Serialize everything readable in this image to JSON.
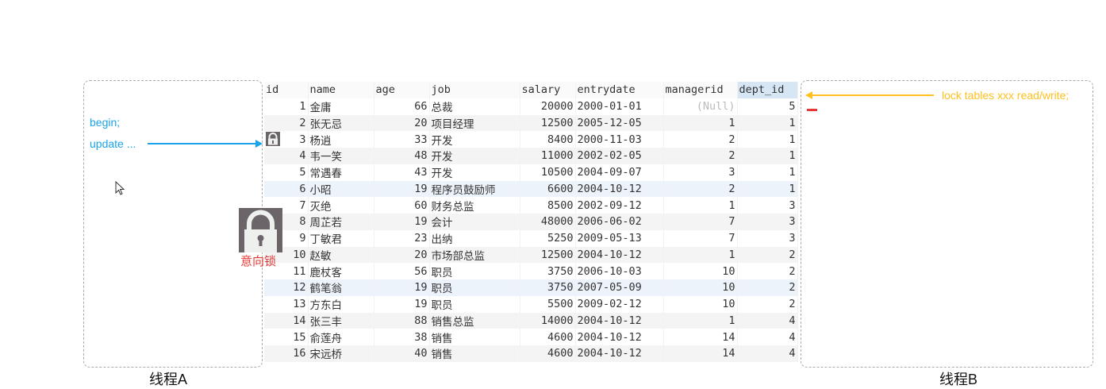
{
  "threadA": {
    "label": "线程A",
    "lines": [
      "begin;",
      "update ..."
    ]
  },
  "threadB": {
    "label": "线程B",
    "statement": "lock tables xxx read/write;"
  },
  "lock": {
    "label": "意向锁"
  },
  "colors": {
    "blue": "#1aa3e8",
    "orange": "#ffc020",
    "red": "#e53935"
  },
  "table": {
    "columns": [
      "id",
      "name",
      "age",
      "job",
      "salary",
      "entrydate",
      "managerid",
      "dept_id"
    ],
    "rows": [
      [
        "1",
        "金庸",
        "66",
        "总裁",
        "20000",
        "2000-01-01",
        "(Null)",
        "5"
      ],
      [
        "2",
        "张无忌",
        "20",
        "项目经理",
        "12500",
        "2005-12-05",
        "1",
        "1"
      ],
      [
        "3",
        "杨逍",
        "33",
        "开发",
        "8400",
        "2000-11-03",
        "2",
        "1"
      ],
      [
        "4",
        "韦一笑",
        "48",
        "开发",
        "11000",
        "2002-02-05",
        "2",
        "1"
      ],
      [
        "5",
        "常遇春",
        "43",
        "开发",
        "10500",
        "2004-09-07",
        "3",
        "1"
      ],
      [
        "6",
        "小昭",
        "19",
        "程序员鼓励师",
        "6600",
        "2004-10-12",
        "2",
        "1"
      ],
      [
        "7",
        "灭绝",
        "60",
        "财务总监",
        "8500",
        "2002-09-12",
        "1",
        "3"
      ],
      [
        "8",
        "周芷若",
        "19",
        "会计",
        "48000",
        "2006-06-02",
        "7",
        "3"
      ],
      [
        "9",
        "丁敏君",
        "23",
        "出纳",
        "5250",
        "2009-05-13",
        "7",
        "3"
      ],
      [
        "10",
        "赵敏",
        "20",
        "市场部总监",
        "12500",
        "2004-10-12",
        "1",
        "2"
      ],
      [
        "11",
        "鹿杖客",
        "56",
        "职员",
        "3750",
        "2006-10-03",
        "10",
        "2"
      ],
      [
        "12",
        "鹤笔翁",
        "19",
        "职员",
        "3750",
        "2007-05-09",
        "10",
        "2"
      ],
      [
        "13",
        "方东白",
        "19",
        "职员",
        "5500",
        "2009-02-12",
        "10",
        "2"
      ],
      [
        "14",
        "张三丰",
        "88",
        "销售总监",
        "14000",
        "2004-10-12",
        "1",
        "4"
      ],
      [
        "15",
        "俞莲舟",
        "38",
        "销售",
        "4600",
        "2004-10-12",
        "14",
        "4"
      ],
      [
        "16",
        "宋远桥",
        "40",
        "销售",
        "4600",
        "2004-10-12",
        "14",
        "4"
      ]
    ]
  }
}
